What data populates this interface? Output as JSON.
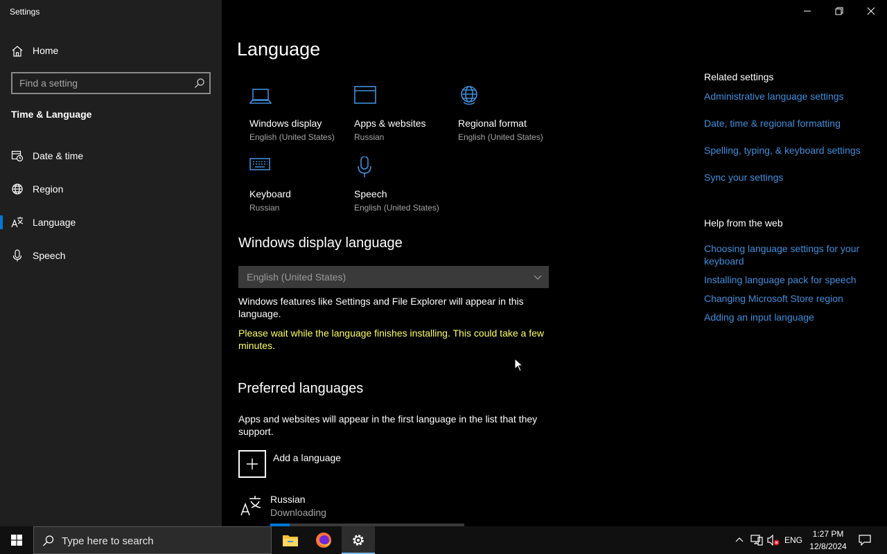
{
  "window": {
    "title": "Settings"
  },
  "sidebar": {
    "home_label": "Home",
    "search_placeholder": "Find a setting",
    "section_title": "Time & Language",
    "items": [
      {
        "label": "Date & time",
        "icon": "calendar-clock-icon"
      },
      {
        "label": "Region",
        "icon": "globe-icon"
      },
      {
        "label": "Language",
        "icon": "language-icon",
        "active": true
      },
      {
        "label": "Speech",
        "icon": "microphone-icon"
      }
    ]
  },
  "main": {
    "title": "Language",
    "tiles": [
      {
        "title": "Windows display",
        "subtitle": "English (United States)",
        "icon": "laptop-icon"
      },
      {
        "title": "Apps & websites",
        "subtitle": "Russian",
        "icon": "window-icon"
      },
      {
        "title": "Regional format",
        "subtitle": "English (United States)",
        "icon": "globe-icon"
      },
      {
        "title": "Keyboard",
        "subtitle": "Russian",
        "icon": "keyboard-icon"
      },
      {
        "title": "Speech",
        "subtitle": "English (United States)",
        "icon": "microphone-icon"
      }
    ],
    "display_language": {
      "heading": "Windows display language",
      "selected": "English (United States)",
      "description": "Windows features like Settings and File Explorer will appear in this language.",
      "warning": "Please wait while the language finishes installing. This could take a few minutes."
    },
    "preferred": {
      "heading": "Preferred languages",
      "description": "Apps and websites will appear in the first language in the list that they support.",
      "add_label": "Add a language",
      "languages": [
        {
          "name": "Russian",
          "status": "Downloading",
          "progress": 0.1
        }
      ]
    }
  },
  "related": {
    "heading": "Related settings",
    "links": [
      "Administrative language settings",
      "Date, time & regional formatting",
      "Spelling, typing, & keyboard settings",
      "Sync your settings"
    ]
  },
  "help": {
    "heading": "Help from the web",
    "links": [
      "Choosing language settings for your keyboard",
      "Installing language pack for speech",
      "Changing Microsoft Store region",
      "Adding an input language"
    ]
  },
  "taskbar": {
    "search_placeholder": "Type here to search",
    "apps": [
      "file-explorer-icon",
      "firefox-icon",
      "settings-gear-icon"
    ],
    "tray": {
      "lang": "ENG",
      "time": "1:27 PM",
      "date": "12/8/2024"
    }
  },
  "colors": {
    "accent": "#0078d7",
    "link": "#3f8fdd",
    "warning": "#ffff64",
    "sidebar_bg": "#1f1f1f"
  }
}
